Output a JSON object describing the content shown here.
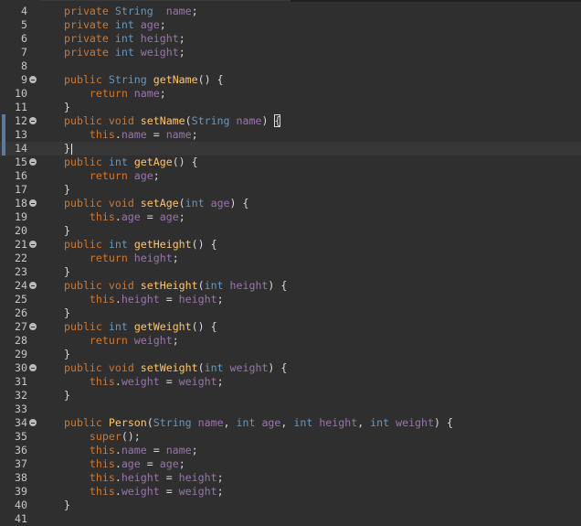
{
  "editor": {
    "language": "java",
    "colors": {
      "background": "#2f2f2f",
      "keyword": "#cc7832",
      "type": "#6897bb",
      "method": "#ffc66d",
      "field": "#9876aa",
      "text": "#d9d9d9",
      "line_number": "#c7c7c7"
    },
    "lines": [
      {
        "n": "4",
        "fold": false,
        "text": "private String  name;"
      },
      {
        "n": "5",
        "fold": false,
        "text": "private int age;"
      },
      {
        "n": "6",
        "fold": false,
        "text": "private int height;"
      },
      {
        "n": "7",
        "fold": false,
        "text": "private int weight;"
      },
      {
        "n": "8",
        "fold": false,
        "text": ""
      },
      {
        "n": "9",
        "fold": true,
        "text": "public String getName() {"
      },
      {
        "n": "10",
        "fold": false,
        "text": "    return name;"
      },
      {
        "n": "11",
        "fold": false,
        "text": "}"
      },
      {
        "n": "12",
        "fold": true,
        "text": "public void setName(String name) {"
      },
      {
        "n": "13",
        "fold": false,
        "text": "    this.name = name;"
      },
      {
        "n": "14",
        "fold": false,
        "text": "}"
      },
      {
        "n": "15",
        "fold": true,
        "text": "public int getAge() {"
      },
      {
        "n": "16",
        "fold": false,
        "text": "    return age;"
      },
      {
        "n": "17",
        "fold": false,
        "text": "}"
      },
      {
        "n": "18",
        "fold": true,
        "text": "public void setAge(int age) {"
      },
      {
        "n": "19",
        "fold": false,
        "text": "    this.age = age;"
      },
      {
        "n": "20",
        "fold": false,
        "text": "}"
      },
      {
        "n": "21",
        "fold": true,
        "text": "public int getHeight() {"
      },
      {
        "n": "22",
        "fold": false,
        "text": "    return height;"
      },
      {
        "n": "23",
        "fold": false,
        "text": "}"
      },
      {
        "n": "24",
        "fold": true,
        "text": "public void setHeight(int height) {"
      },
      {
        "n": "25",
        "fold": false,
        "text": "    this.height = height;"
      },
      {
        "n": "26",
        "fold": false,
        "text": "}"
      },
      {
        "n": "27",
        "fold": true,
        "text": "public int getWeight() {"
      },
      {
        "n": "28",
        "fold": false,
        "text": "    return weight;"
      },
      {
        "n": "29",
        "fold": false,
        "text": "}"
      },
      {
        "n": "30",
        "fold": true,
        "text": "public void setWeight(int weight) {"
      },
      {
        "n": "31",
        "fold": false,
        "text": "    this.weight = weight;"
      },
      {
        "n": "32",
        "fold": false,
        "text": "}"
      },
      {
        "n": "33",
        "fold": false,
        "text": ""
      },
      {
        "n": "34",
        "fold": true,
        "text": "public Person(String name, int age, int height, int weight) {"
      },
      {
        "n": "35",
        "fold": false,
        "text": "    super();"
      },
      {
        "n": "36",
        "fold": false,
        "text": "    this.name = name;"
      },
      {
        "n": "37",
        "fold": false,
        "text": "    this.age = age;"
      },
      {
        "n": "38",
        "fold": false,
        "text": "    this.height = height;"
      },
      {
        "n": "39",
        "fold": false,
        "text": "    this.weight = weight;"
      },
      {
        "n": "40",
        "fold": false,
        "text": "}"
      },
      {
        "n": "41",
        "fold": false,
        "text": ""
      }
    ],
    "current_line": "14",
    "changed_lines": [
      "12",
      "13",
      "14"
    ],
    "matched_bracket_line": "12",
    "fold_icon": "collapse-minus-icon"
  }
}
